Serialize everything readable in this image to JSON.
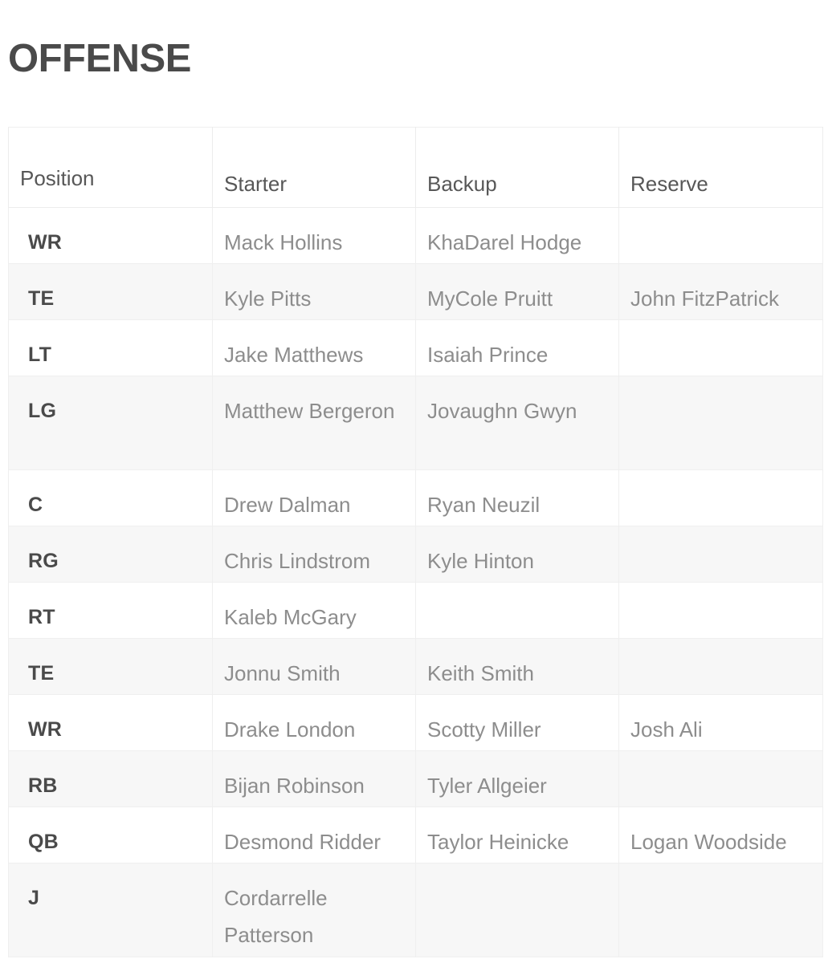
{
  "page": {
    "title": "OFFENSE",
    "background_color": "#ffffff",
    "title_color": "#4a4a4a",
    "row_stripe_color": "#f7f7f7",
    "border_color": "#efefef",
    "position_text_color": "#4a4a4a",
    "player_text_color": "#8d8d8d",
    "header_text_color": "#575757"
  },
  "table": {
    "name": "offense-depth-chart",
    "columns": [
      {
        "key": "position",
        "label": "Position"
      },
      {
        "key": "starter",
        "label": "Starter"
      },
      {
        "key": "backup",
        "label": "Backup"
      },
      {
        "key": "reserve",
        "label": "Reserve"
      }
    ],
    "rows": [
      {
        "position": "WR",
        "starter": "Mack Hollins",
        "backup": "KhaDarel Hodge",
        "reserve": ""
      },
      {
        "position": "TE",
        "starter": "Kyle Pitts",
        "backup": "MyCole Pruitt",
        "reserve": "John FitzPatrick"
      },
      {
        "position": "LT",
        "starter": "Jake Matthews",
        "backup": "Isaiah Prince",
        "reserve": ""
      },
      {
        "position": "LG",
        "starter": "Matthew Bergeron",
        "backup": "Jovaughn Gwyn",
        "reserve": ""
      },
      {
        "position": "C",
        "starter": "Drew Dalman",
        "backup": "Ryan Neuzil",
        "reserve": ""
      },
      {
        "position": "RG",
        "starter": "Chris Lindstrom",
        "backup": "Kyle Hinton",
        "reserve": ""
      },
      {
        "position": "RT",
        "starter": "Kaleb McGary",
        "backup": "",
        "reserve": ""
      },
      {
        "position": "TE",
        "starter": "Jonnu Smith",
        "backup": "Keith Smith",
        "reserve": ""
      },
      {
        "position": "WR",
        "starter": "Drake London",
        "backup": "Scotty Miller",
        "reserve": "Josh Ali"
      },
      {
        "position": "RB",
        "starter": "Bijan Robinson",
        "backup": "Tyler Allgeier",
        "reserve": ""
      },
      {
        "position": "QB",
        "starter": "Desmond Ridder",
        "backup": "Taylor Heinicke",
        "reserve": "Logan Woodside"
      },
      {
        "position": "J",
        "starter": "Cordarrelle Patterson",
        "backup": "",
        "reserve": ""
      }
    ]
  }
}
